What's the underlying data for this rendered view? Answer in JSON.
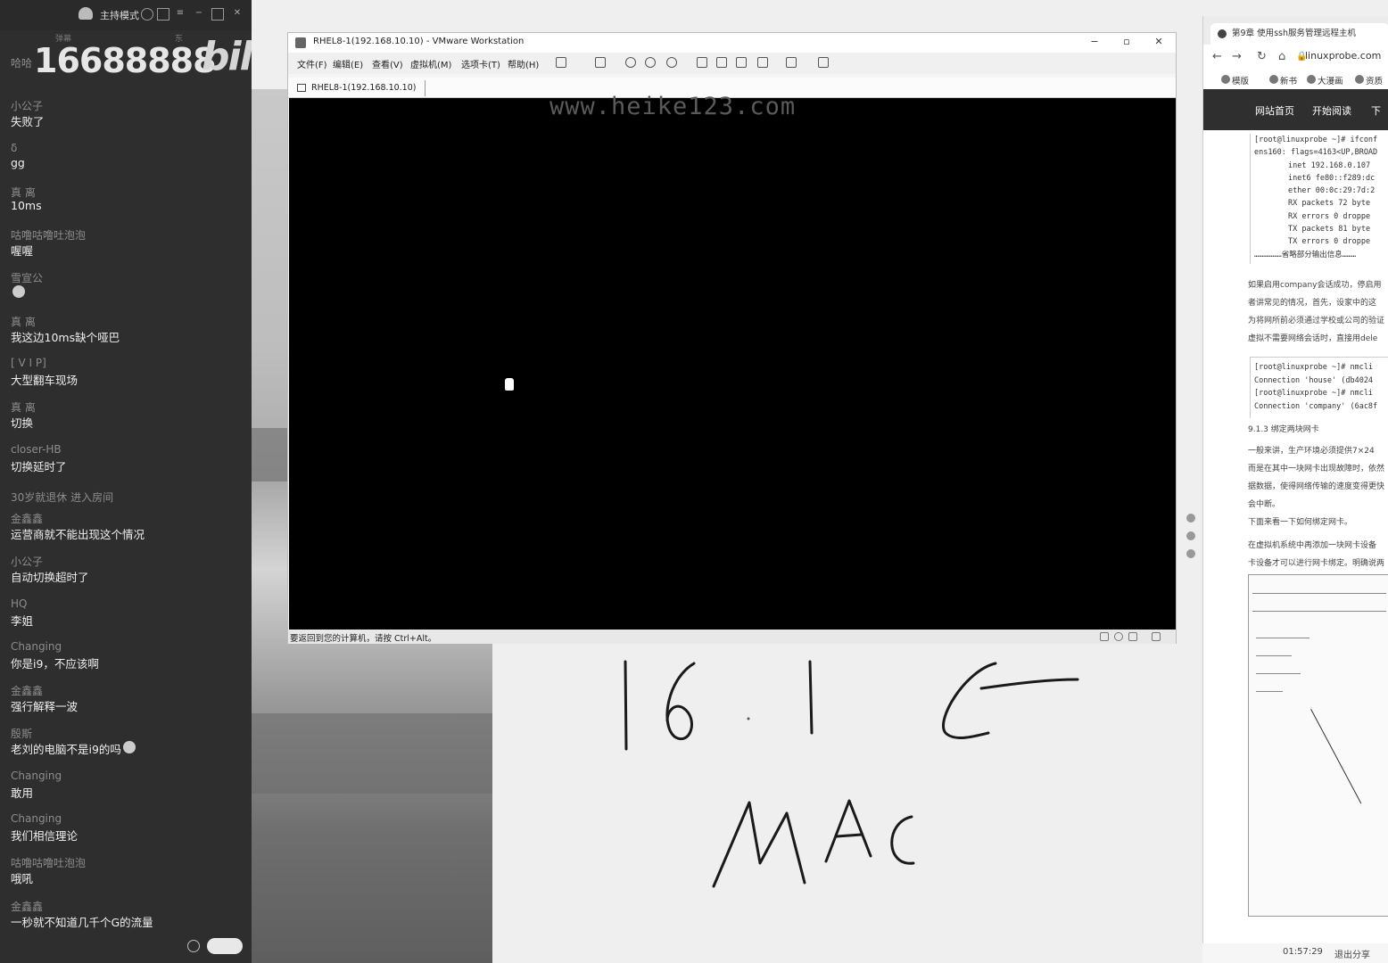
{
  "chat": {
    "mode_label": "主持模式",
    "sub_left": "弹幕",
    "sub_right": "东",
    "gift_number": "16688888",
    "brand": "bilib",
    "messages": [
      {
        "user": "哈哈",
        "text": ""
      },
      {
        "user": "小公子",
        "text": "失败了"
      },
      {
        "user": "δ",
        "text": "gg"
      },
      {
        "user": "真 离",
        "text": "10ms"
      },
      {
        "user": "咕噜咕噜吐泡泡",
        "text": "喔喔"
      },
      {
        "user": "雪宣公",
        "text": ""
      },
      {
        "user": "真 离",
        "text": "我这边10ms缺个哑巴"
      },
      {
        "user": "[ V I P]",
        "text": "大型翻车现场"
      },
      {
        "user": "真 离",
        "text": "切换"
      },
      {
        "user": "closer-HB",
        "text": "切换延时了"
      },
      {
        "user": "30岁就退休 进入房间",
        "text": ""
      },
      {
        "user": "金鑫鑫",
        "text": "运营商就不能出现这个情况"
      },
      {
        "user": "小公子",
        "text": "自动切换超时了"
      },
      {
        "user": "HQ",
        "text": "李姐"
      },
      {
        "user": "Changing",
        "text": "你是i9，不应该啊"
      },
      {
        "user": "金鑫鑫",
        "text": "强行解释一波"
      },
      {
        "user": "殷斯",
        "text": "老刘的电脑不是i9的吗"
      },
      {
        "user": "Changing",
        "text": "敢用"
      },
      {
        "user": "Changing",
        "text": "我们相信理论"
      },
      {
        "user": "咕噜咕噜吐泡泡",
        "text": "哦吼"
      },
      {
        "user": "金鑫鑫",
        "text": "一秒就不知道几千个G的流量"
      }
    ]
  },
  "vmware": {
    "title": "RHEL8-1(192.168.10.10) - VMware Workstation",
    "menu": [
      "文件(F)",
      "编辑(E)",
      "查看(V)",
      "虚拟机(M)",
      "选项卡(T)",
      "帮助(H)"
    ],
    "tab": "RHEL8-1(192.168.10.10)",
    "watermark": "www.heike123.com",
    "status": "要返回到您的计算机，请按 Ctrl+Alt。"
  },
  "board": {
    "line1": "16 1 C←",
    "line2": "MAC"
  },
  "browser": {
    "tab_title": "第9章 使用ssh服务管理远程主机",
    "url": "linuxprobe.com",
    "bookmarks": [
      "模版",
      "新书",
      "大漫画",
      "资质"
    ],
    "site_nav": [
      "网站首页",
      "开始阅读",
      "下"
    ],
    "code1": [
      "[root@linuxprobe ~]# ifconf",
      "ens160: flags=4163<UP,BROAD",
      "      inet 192.168.0.107",
      "      inet6 fe80::f289:dc",
      "      ether 00:0c:29:7d:2",
      "      RX packets 72  byte",
      "      RX errors 0  droppe",
      "      TX packets 81  byte",
      "      TX errors 0  droppe",
      "………………省略部分输出信息………"
    ],
    "para1": [
      "如果启用company会话成功，停启用",
      "者讲常见的情况，首先，设家中的这",
      "为将网所前必须通过学校或公司的验证"
    ],
    "para2": "虚拟不需要网络会话时，直接用dele",
    "code2": [
      "[root@linuxprobe ~]# nmcli",
      "Connection 'house' (db4024",
      "[root@linuxprobe ~]# nmcli",
      "Connection 'company' (6ac8f"
    ],
    "section": "9.1.3 绑定两块网卡",
    "para3": [
      "一般来讲，生产环境必须提供7×24",
      "而是在其中一块网卡出现故障时，依然",
      "据数据，使得网络传输的速度变得更快",
      "会中断。"
    ],
    "para4": "下面来看一下如何绑定网卡。",
    "para5": [
      "在虚拟机系统中再添加一块网卡设备",
      "卡设备才可以进行网卡绑定。明确说两"
    ],
    "clock": "01:57:29",
    "leave": "退出分享"
  }
}
